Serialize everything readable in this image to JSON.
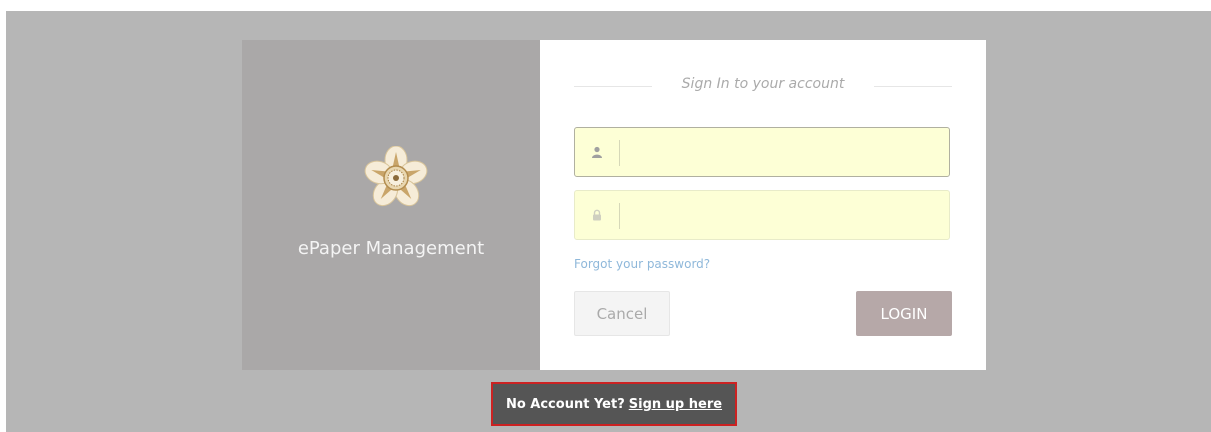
{
  "brand": {
    "title": "ePaper Management",
    "logo_icon": "gadjah-mada-emblem-icon"
  },
  "login": {
    "heading": "Sign In to your account",
    "username": {
      "icon": "user-icon",
      "value": "",
      "placeholder": ""
    },
    "password": {
      "icon": "lock-icon",
      "value": "",
      "placeholder": ""
    },
    "forgot_label": "Forgot your password?",
    "cancel_label": "Cancel",
    "login_label": "LOGIN"
  },
  "signup": {
    "prompt": "No Account Yet?",
    "link_label": "Sign up here"
  },
  "colors": {
    "page_bg": "#b6b6b6",
    "brand_panel": "#aaa8a8",
    "input_bg": "#fdffd6",
    "login_button": "#b6a8a8",
    "link": "#8fb8da",
    "signup_bar": "#555555",
    "highlight_border": "#cc2222"
  }
}
